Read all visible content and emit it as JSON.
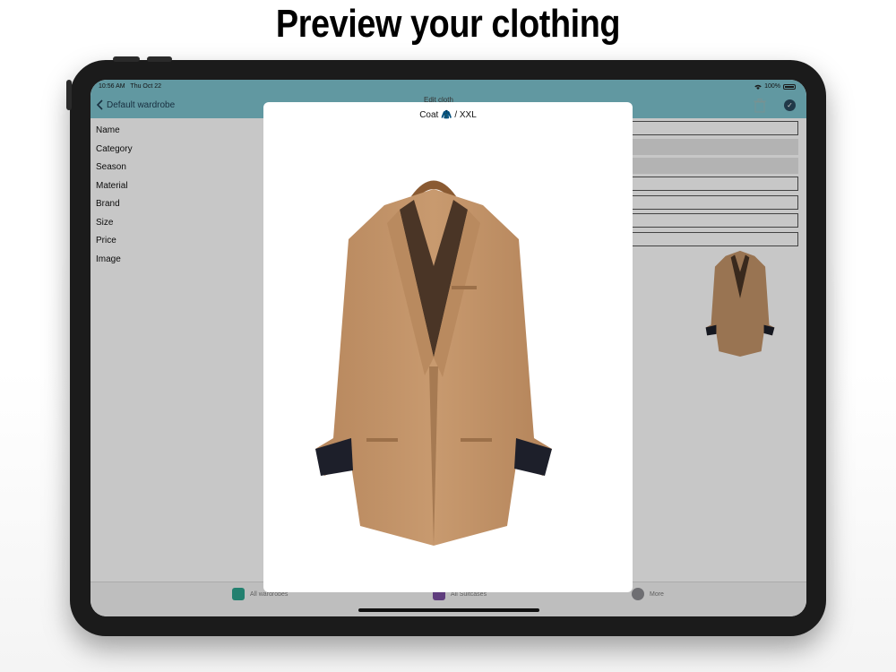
{
  "headline": "Preview your clothing",
  "status_bar": {
    "time": "10:56 AM",
    "date": "Thu Oct 22",
    "battery": "100%"
  },
  "nav": {
    "back_label": "Default wardrobe",
    "title": "Edit cloth"
  },
  "form": {
    "labels": [
      "Name",
      "Category",
      "Season",
      "Material",
      "Brand",
      "Size",
      "Price",
      "Image"
    ]
  },
  "modal": {
    "title": "Coat 🧥 / XXL"
  },
  "tabs": {
    "wardrobes": "All wardrobes",
    "suitcases": "All Suitcases",
    "more": "More"
  },
  "colors": {
    "nav_bar": "#7dc3cf",
    "coat": "#c4956a",
    "tab_wardrobes": "#2ea58f",
    "tab_suitcases": "#7a4fa0",
    "tab_more": "#8e8e93"
  },
  "icons": {
    "back": "chevron-left-icon",
    "trash": "trash-icon",
    "done": "checkmark-circle-icon",
    "wifi": "wifi-icon",
    "battery": "battery-icon"
  }
}
